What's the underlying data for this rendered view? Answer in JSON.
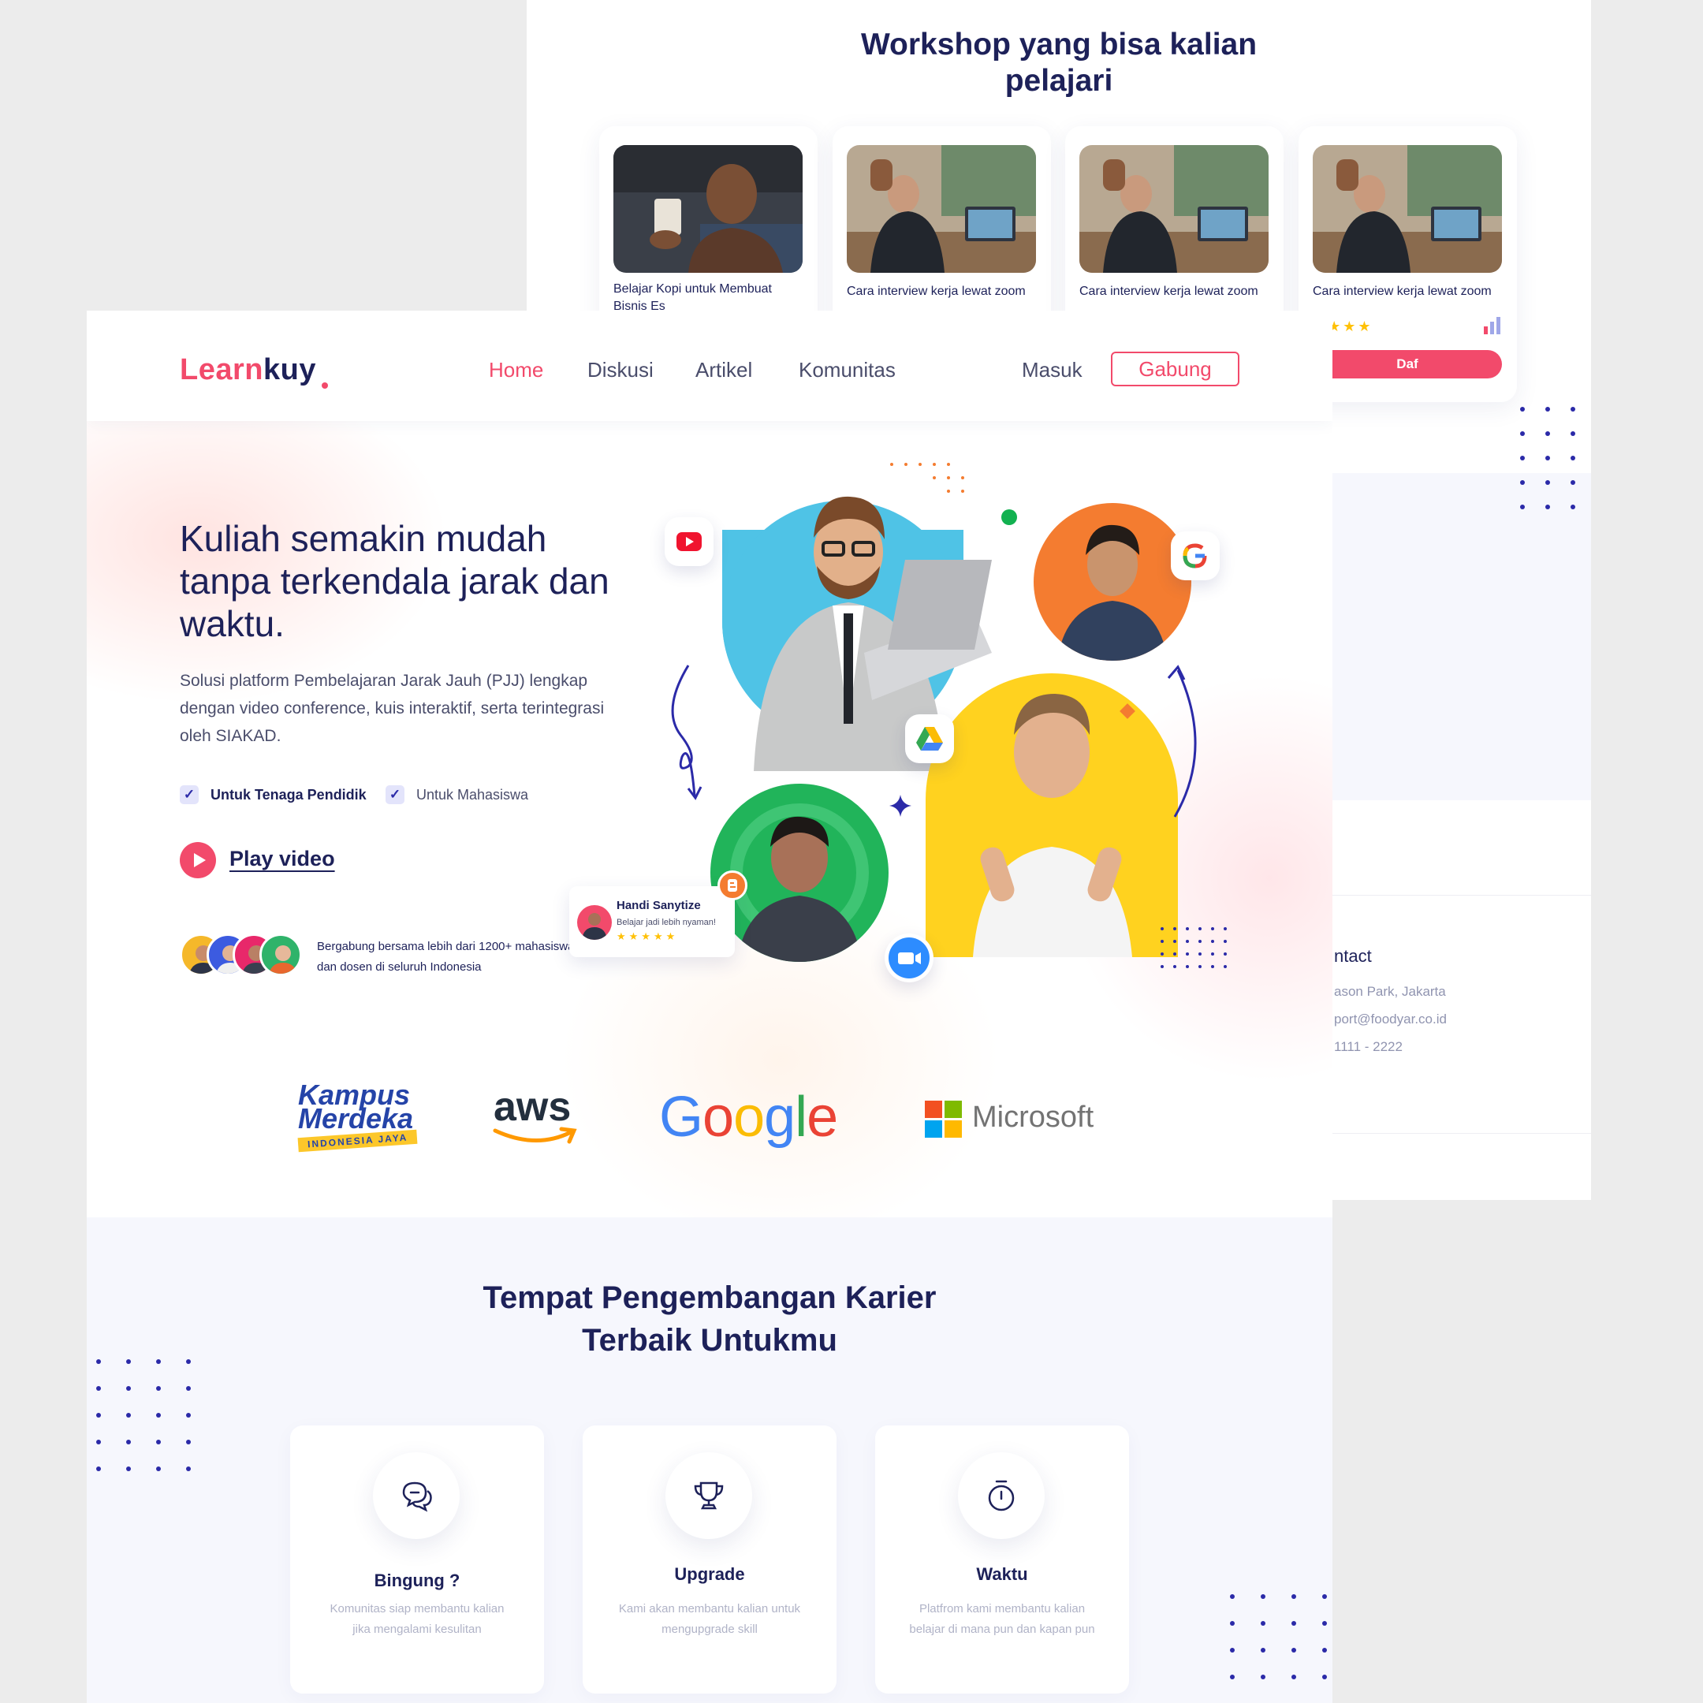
{
  "back": {
    "section_title": "Workshop yang bisa kalian pelajari",
    "cards": [
      {
        "title": "Belajar Kopi untuk Membuat Bisnis Es"
      },
      {
        "title": "Cara interview kerja lewat zoom"
      },
      {
        "title": "Cara interview kerja lewat zoom"
      },
      {
        "title": "Cara interview kerja lewat zoom",
        "stars": "★★★★",
        "button": "Daf"
      }
    ],
    "contact": {
      "title": "ntact",
      "address": "ason Park, Jakarta",
      "email": "port@foodyar.co.id",
      "phone": "1111 - 2222"
    }
  },
  "nav": {
    "logo_part1": "Learn",
    "logo_part2": "kuy",
    "links": [
      "Home",
      "Diskusi",
      "Artikel",
      "Komunitas"
    ],
    "active": "Home",
    "login": "Masuk",
    "signup": "Gabung"
  },
  "hero": {
    "title": "Kuliah semakin mudah tanpa terkendala jarak dan waktu.",
    "subtitle": "Solusi platform Pembelajaran Jarak Jauh (PJJ) lengkap dengan video conference, kuis interaktif, serta terintegrasi oleh SIAKAD.",
    "check1": "Untuk Tenaga Pendidik",
    "check2": "Untuk Mahasiswa",
    "play": "Play video",
    "join_text": "Bergabung bersama lebih dari 1200+ mahasiswa dan dosen di seluruh Indonesia",
    "review": {
      "name": "Handi Sanytize",
      "text": "Belajar jadi lebih nyaman!",
      "stars": "★★★★★"
    }
  },
  "partners": {
    "kampus_line1": "Kampus",
    "kampus_line2": "Merdeka",
    "kampus_tagline": "INDONESIA JAYA",
    "aws": "aws",
    "google": [
      "G",
      "o",
      "o",
      "g",
      "l",
      "e"
    ],
    "microsoft": "Microsoft"
  },
  "career": {
    "title_line1": "Tempat Pengembangan Karier",
    "title_line2": "Terbaik Untukmu",
    "features": [
      {
        "title": "Bingung ?",
        "desc": "Komunitas siap membantu kalian jika mengalami kesulitan",
        "icon": "chat-icon"
      },
      {
        "title": "Upgrade",
        "desc": "Kami akan membantu kalian untuk mengupgrade skill",
        "icon": "trophy-icon"
      },
      {
        "title": "Waktu",
        "desc": "Platfrom kami membantu kalian belajar di mana pun dan kapan pun",
        "icon": "stopwatch-icon"
      }
    ]
  },
  "colors": {
    "brand": "#f24a6b",
    "navy": "#1d2159",
    "accent": "#2b2aa8"
  }
}
